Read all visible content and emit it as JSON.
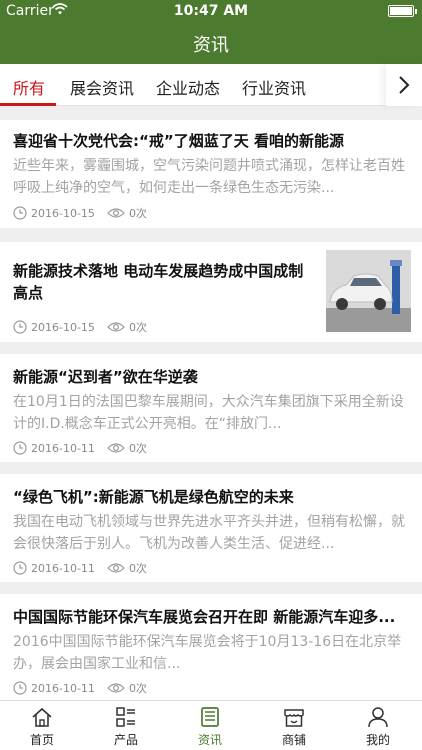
{
  "status_bar": {
    "carrier": "Carrier",
    "time": "10:47 AM"
  },
  "nav": {
    "title": "资讯"
  },
  "tabs": [
    {
      "label": "所有",
      "active": true
    },
    {
      "label": "展会资讯",
      "active": false
    },
    {
      "label": "企业动态",
      "active": false
    },
    {
      "label": "行业资讯",
      "active": false
    }
  ],
  "articles": [
    {
      "title": "喜迎省十次党代会:“戒”了烟蓝了天 看咱的新能源",
      "summary": "近些年来，雾霾围城，空气污染问题井喷式涌现，怎样让老百姓呼吸上纯净的空气，如何走出一条绿色生态无污染...",
      "date": "2016-10-15",
      "views": "0次"
    },
    {
      "title": "新能源技术落地 电动车发展趋势成中国成制高点",
      "date": "2016-10-15",
      "views": "0次",
      "has_image": true
    },
    {
      "title": "新能源“迟到者”欲在华逆袭",
      "summary": "在10月1日的法国巴黎车展期间，大众汽车集团旗下采用全新设计的I.D.概念车正式公开亮相。在“排放门...",
      "date": "2016-10-11",
      "views": "0次"
    },
    {
      "title": "“绿色飞机”:新能源飞机是绿色航空的未来",
      "summary": "我国在电动飞机领域与世界先进水平齐头并进，但稍有松懈，就会很快落后于别人。飞机为改善人类生活、促进经...",
      "date": "2016-10-11",
      "views": "0次"
    },
    {
      "title": "中国国际节能环保汽车展览会召开在即 新能源汽车迎多...",
      "summary": "2016中国国际节能环保汽车展览会将于10月13-16日在北京举办，展会由国家工业和信...",
      "date": "2016-10-11",
      "views": "0次"
    }
  ],
  "tab_bar": [
    {
      "label": "首页",
      "icon": "home-icon"
    },
    {
      "label": "产品",
      "icon": "grid-list-icon"
    },
    {
      "label": "资讯",
      "icon": "news-icon",
      "active": true
    },
    {
      "label": "商铺",
      "icon": "store-icon"
    },
    {
      "label": "我的",
      "icon": "user-icon"
    }
  ],
  "colors": {
    "brand_green": "#4c7a2e",
    "tab_active_red": "#c9171e",
    "summary_gray": "#a3a3a3"
  }
}
